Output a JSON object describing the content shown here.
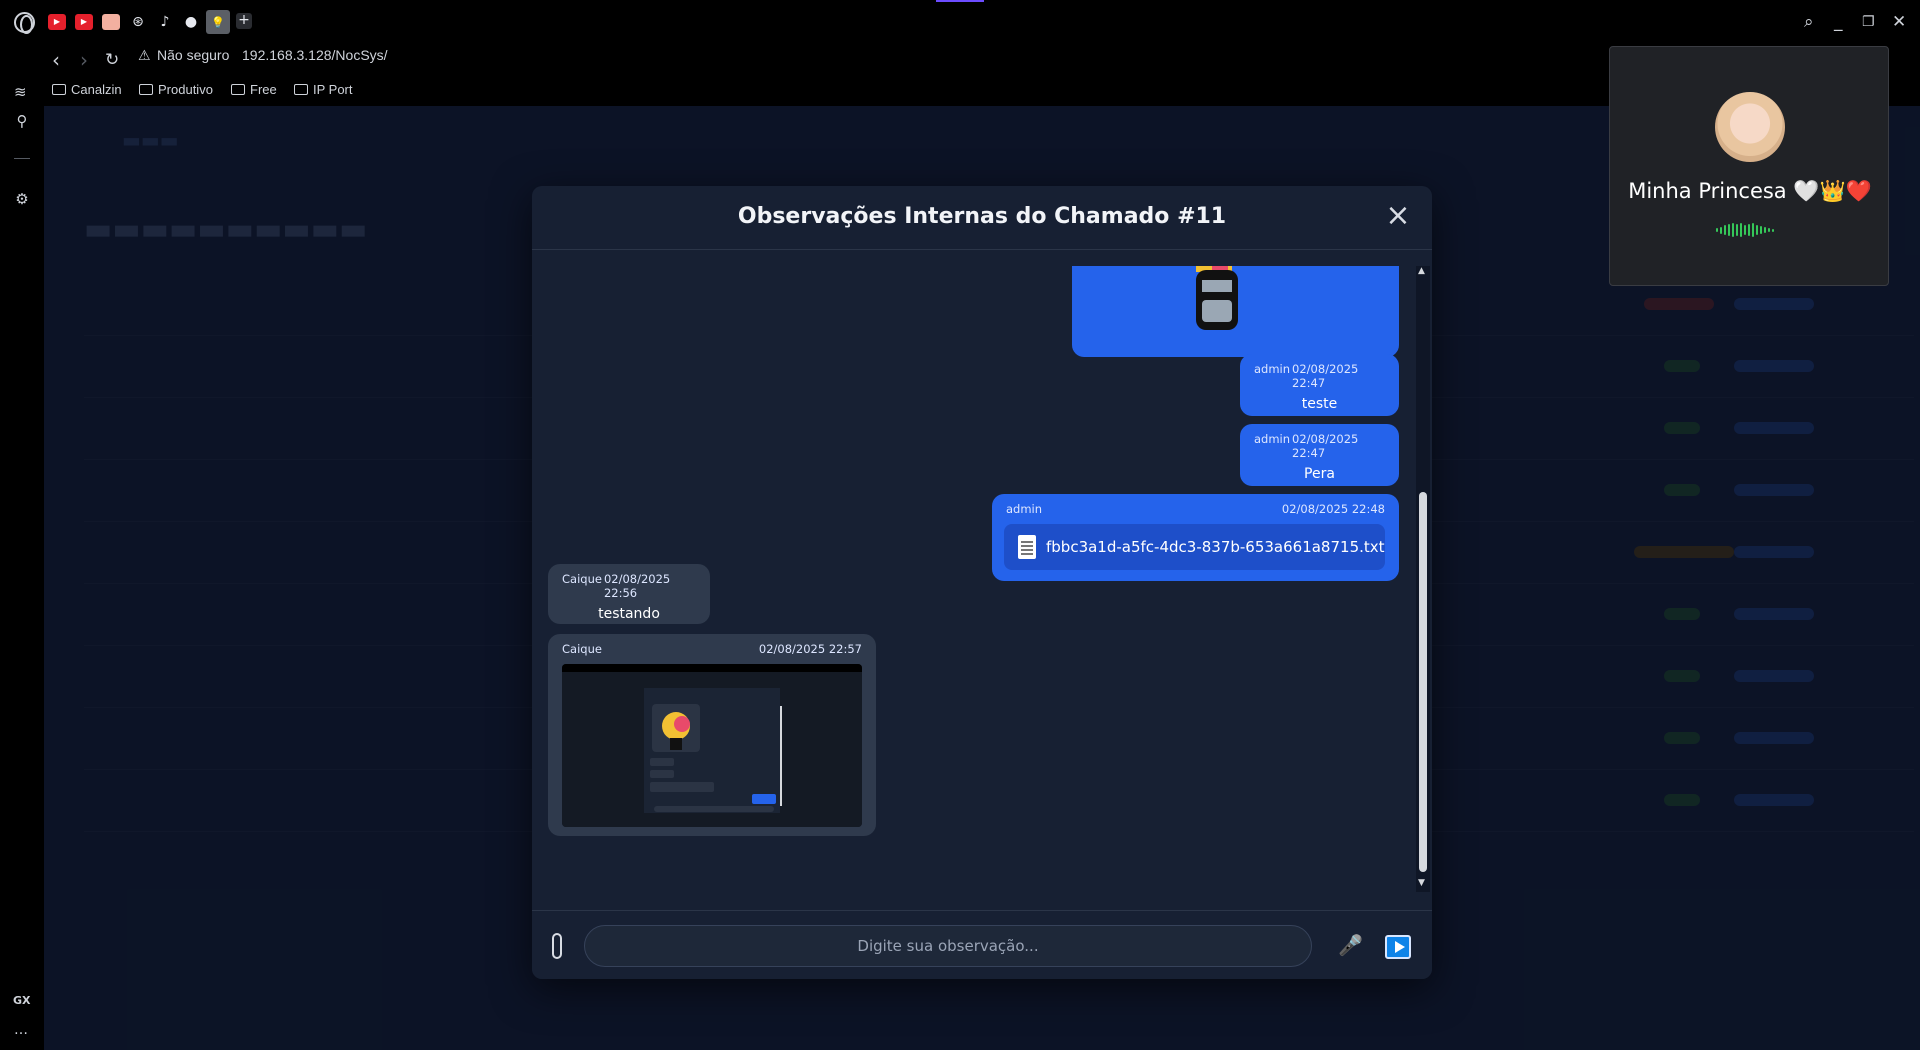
{
  "browser": {
    "url_warning": "Não seguro",
    "url": "192.168.3.128/NocSys/",
    "bookmarks": [
      "Canalzin",
      "Produtivo",
      "Free",
      "IP Port"
    ],
    "sidebar_label": "GX",
    "sidebar_more": "…"
  },
  "modal": {
    "title": "Observações Internas do Chamado #11",
    "close_label": "×",
    "messages": [
      {
        "author": "admin",
        "time": "02/08/2025 22:47",
        "text": "teste"
      },
      {
        "author": "admin",
        "time": "02/08/2025 22:47",
        "text": "Pera"
      },
      {
        "author": "admin",
        "time": "02/08/2025 22:48",
        "file": "fbbc3a1d-a5fc-4dc3-837b-653a661a8715.txt"
      },
      {
        "author": "Caique",
        "time": "02/08/2025 22:56",
        "text": "testando"
      },
      {
        "author": "Caique",
        "time": "02/08/2025 22:57"
      }
    ],
    "composer": {
      "placeholder": "Digite sua observação..."
    }
  },
  "call": {
    "name": "Minha Princesa 🤍👑❤️"
  },
  "colors": {
    "bubble_me": "#2563eb",
    "bubble_other": "#2f3a4d",
    "modal_bg": "#172033",
    "send_button": "#0e83e8",
    "voice_wave": "#35c759"
  }
}
